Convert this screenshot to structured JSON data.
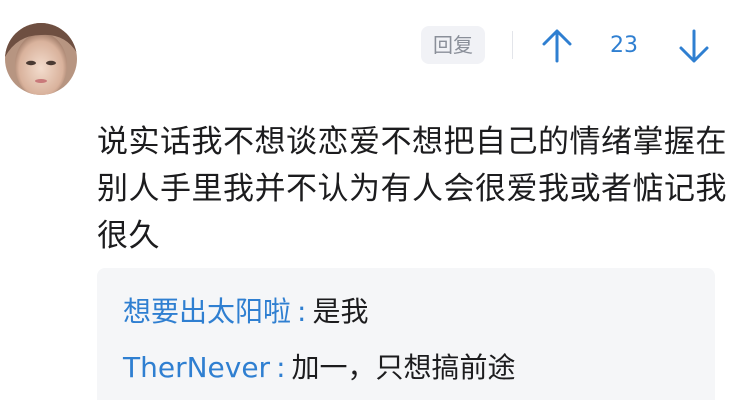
{
  "comment": {
    "reply_label": "回复",
    "vote_count": "23",
    "body": "说实话我不想谈恋爱不想把自己的情绪掌握在别人手里我并不认为有人会很爱我或者惦记我很久",
    "accent_color": "#2f7fd1",
    "icons": {
      "vote_up": "arrow-up-icon",
      "vote_down": "arrow-down-icon"
    }
  },
  "replies": [
    {
      "author": "想要出太阳啦",
      "separator": ":",
      "text": "是我"
    },
    {
      "author": "TherNever",
      "separator": ":",
      "text": "加一，只想搞前途"
    }
  ]
}
